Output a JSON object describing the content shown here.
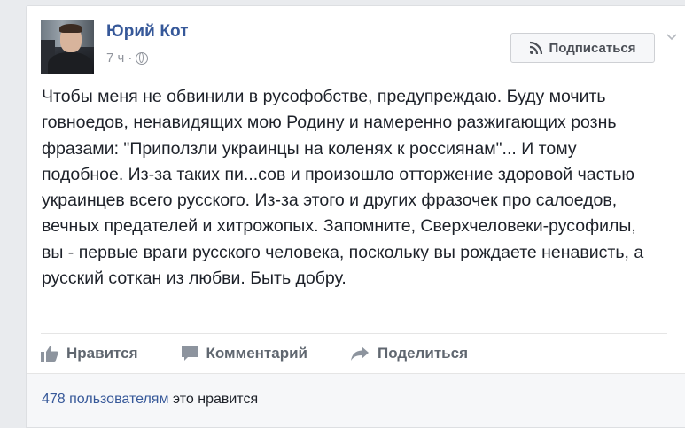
{
  "post": {
    "author": "Юрий Кот",
    "time": "7 ч",
    "separator": "·",
    "privacy_icon": "globe-icon",
    "subscribe_label": "Подписаться",
    "text": "Чтобы меня не обвинили в русофобстве, предупреждаю. Буду мочить говноедов, ненавидящих мою Родину и намеренно разжигающих рознь фразами: \"Приползли украинцы на коленях к россиянам\"... И тому подобное. Из-за таких пи...сов и произошло отторжение здоровой частью украинцев всего русского. Из-за этого и других фразочек про салоедов, вечных предателей и хитрожопых. Запомните, Сверхчеловеки-русофилы, вы - первые враги русского человека, поскольку вы рождаете ненависть, а русский соткан из любви. Быть добру."
  },
  "actions": {
    "like": "Нравится",
    "comment": "Комментарий",
    "share": "Поделиться"
  },
  "likes": {
    "link_text": "478 пользователям",
    "suffix": "это нравится"
  },
  "colors": {
    "link": "#365899",
    "muted": "#90949c",
    "action_text": "#606770"
  }
}
